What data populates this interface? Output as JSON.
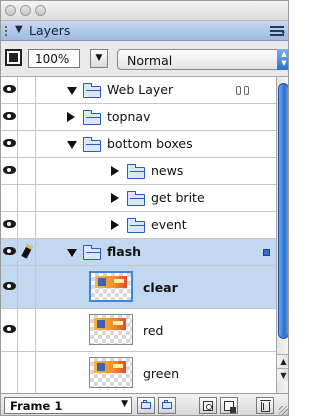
{
  "panel": {
    "title": "Layers",
    "menu_icon": "panel-options-icon"
  },
  "options": {
    "opacity_value": "100%",
    "blend_mode": "Normal"
  },
  "layers": [
    {
      "name": "Web Layer",
      "type": "folder",
      "expanded": true,
      "indent": 0,
      "visible": true,
      "editing": false,
      "locked_link": true
    },
    {
      "name": "topnav",
      "type": "folder",
      "expanded": false,
      "indent": 0,
      "visible": true,
      "editing": false
    },
    {
      "name": "bottom boxes",
      "type": "folder",
      "expanded": true,
      "indent": 0,
      "visible": true,
      "editing": false
    },
    {
      "name": "news",
      "type": "folder",
      "expanded": false,
      "indent": 1,
      "visible": true,
      "editing": false
    },
    {
      "name": "get brite",
      "type": "folder",
      "expanded": false,
      "indent": 1,
      "visible": false,
      "editing": false
    },
    {
      "name": "event",
      "type": "folder",
      "expanded": false,
      "indent": 1,
      "visible": true,
      "editing": false
    },
    {
      "name": "flash",
      "type": "folder",
      "expanded": true,
      "indent": 0,
      "visible": true,
      "editing": true,
      "selected": true,
      "target": true
    },
    {
      "name": "clear",
      "type": "object",
      "indent": 1,
      "visible": true,
      "selected": true
    },
    {
      "name": "red",
      "type": "object",
      "indent": 1,
      "visible": true
    },
    {
      "name": "green",
      "type": "object",
      "indent": 1,
      "visible": false
    }
  ],
  "footer": {
    "frame_label": "Frame 1",
    "buttons": [
      "share-layer-icon",
      "new-sub-layer-icon",
      "new-state-icon",
      "add-mask-icon",
      "trash-icon"
    ]
  },
  "colors": {
    "header_blue": "#9eb9de",
    "selection": "#c2d8f1",
    "scroll_thumb": "#2a6fd0"
  }
}
